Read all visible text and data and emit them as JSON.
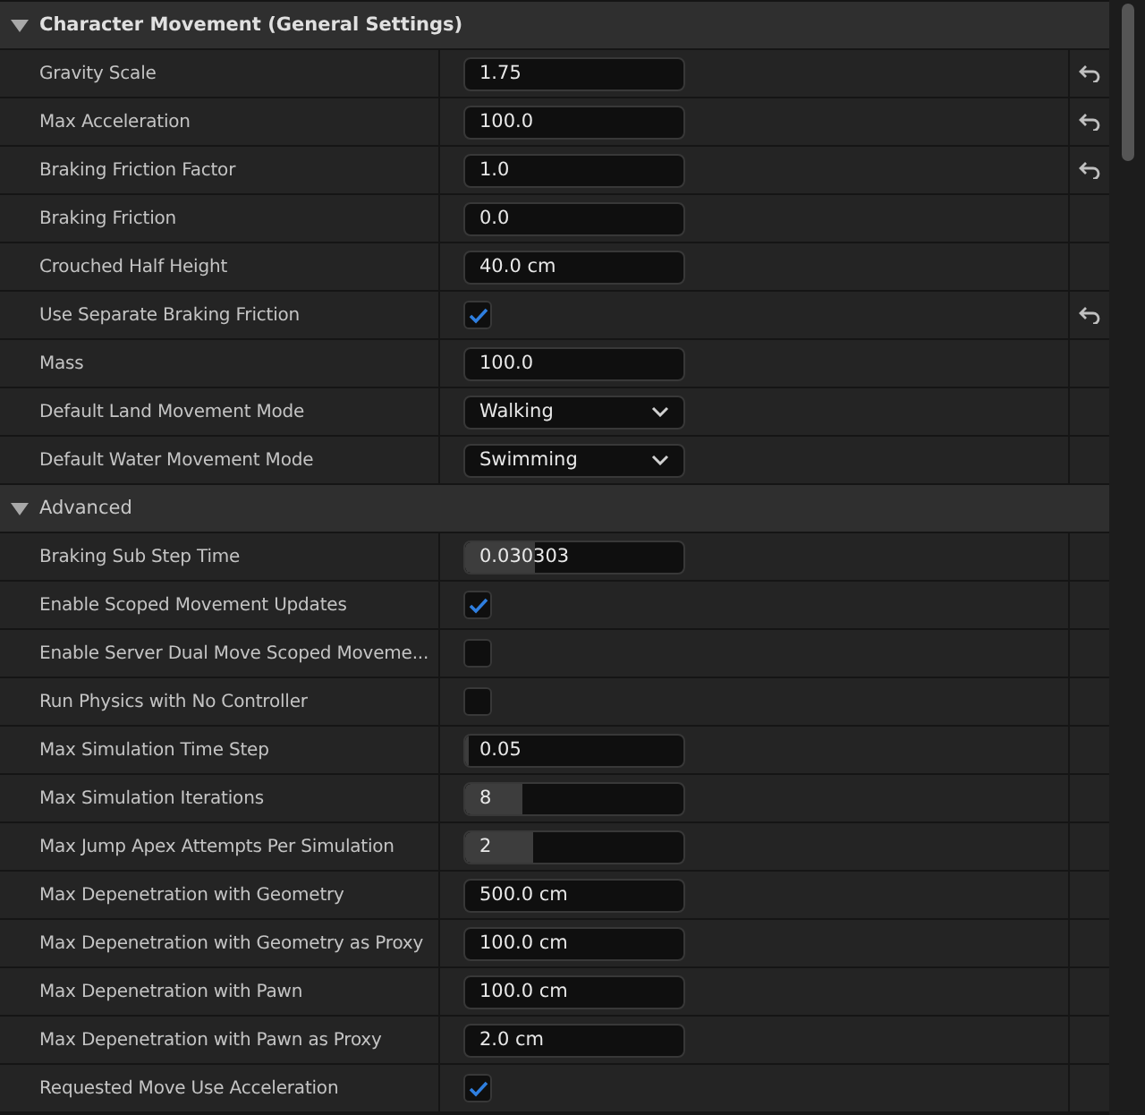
{
  "sections": [
    {
      "title": "Character Movement (General Settings)",
      "expanded": true,
      "rows": [
        {
          "label": "Gravity Scale",
          "kind": "number",
          "value": "1.75",
          "resettable": true
        },
        {
          "label": "Max Acceleration",
          "kind": "number",
          "value": "100.0",
          "resettable": true
        },
        {
          "label": "Braking Friction Factor",
          "kind": "number",
          "value": "1.0",
          "resettable": true
        },
        {
          "label": "Braking Friction",
          "kind": "number",
          "value": "0.0",
          "resettable": false
        },
        {
          "label": "Crouched Half Height",
          "kind": "number",
          "value": "40.0 cm",
          "resettable": false
        },
        {
          "label": "Use Separate Braking Friction",
          "kind": "checkbox",
          "checked": true,
          "resettable": true
        },
        {
          "label": "Mass",
          "kind": "number",
          "value": "100.0",
          "resettable": false
        },
        {
          "label": "Default Land Movement Mode",
          "kind": "dropdown",
          "value": "Walking",
          "resettable": false
        },
        {
          "label": "Default Water Movement Mode",
          "kind": "dropdown",
          "value": "Swimming",
          "resettable": false
        }
      ]
    },
    {
      "title": "Advanced",
      "expanded": true,
      "rows": [
        {
          "label": "Braking Sub Step Time",
          "kind": "slider",
          "value": "0.030303",
          "level": 0.32,
          "resettable": false
        },
        {
          "label": "Enable Scoped Movement Updates",
          "kind": "checkbox",
          "checked": true,
          "resettable": false
        },
        {
          "label": "Enable Server Dual Move Scoped Moveme...",
          "kind": "checkbox",
          "checked": false,
          "resettable": false
        },
        {
          "label": "Run Physics with No Controller",
          "kind": "checkbox",
          "checked": false,
          "resettable": false
        },
        {
          "label": "Max Simulation Time Step",
          "kind": "slider",
          "value": "0.05",
          "level": 0.02,
          "resettable": false
        },
        {
          "label": "Max Simulation Iterations",
          "kind": "slider",
          "value": "8",
          "level": 0.26,
          "resettable": false
        },
        {
          "label": "Max Jump Apex Attempts Per Simulation",
          "kind": "slider",
          "value": "2",
          "level": 0.31,
          "resettable": false
        },
        {
          "label": "Max Depenetration with Geometry",
          "kind": "number",
          "value": "500.0 cm",
          "resettable": false
        },
        {
          "label": "Max Depenetration with Geometry as Proxy",
          "kind": "number",
          "value": "100.0 cm",
          "resettable": false
        },
        {
          "label": "Max Depenetration with Pawn",
          "kind": "number",
          "value": "100.0 cm",
          "resettable": false
        },
        {
          "label": "Max Depenetration with Pawn as Proxy",
          "kind": "number",
          "value": "2.0 cm",
          "resettable": false
        },
        {
          "label": "Requested Move Use Acceleration",
          "kind": "checkbox",
          "checked": true,
          "resettable": false
        }
      ]
    }
  ]
}
